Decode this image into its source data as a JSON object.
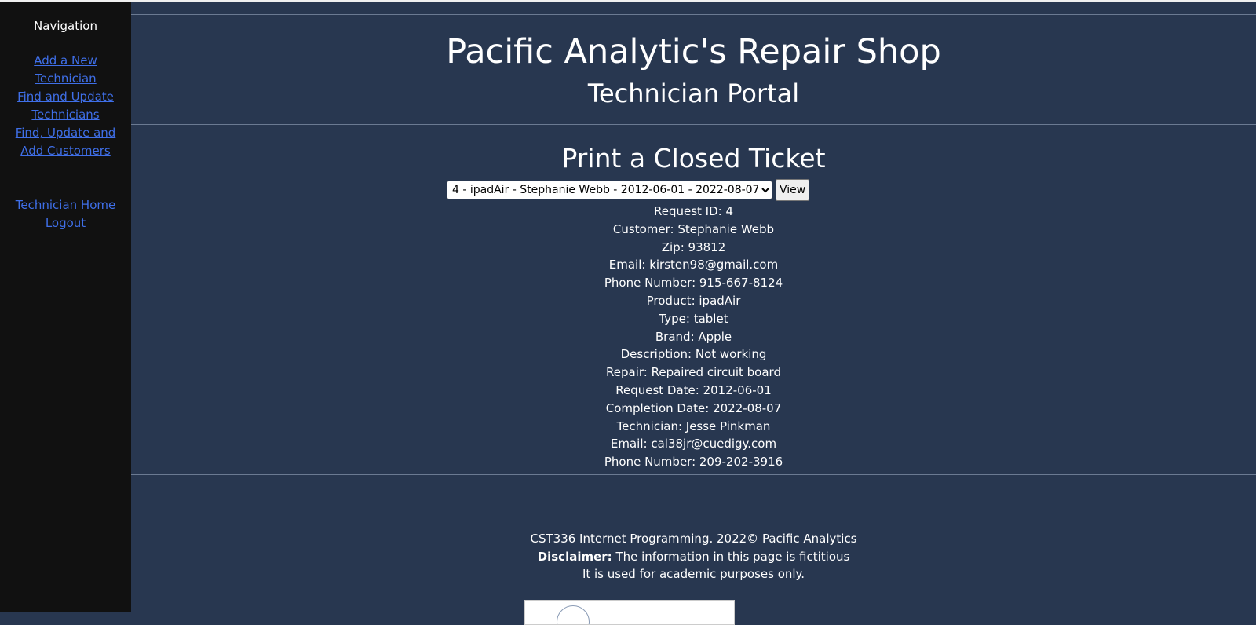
{
  "sidebar": {
    "heading": "Navigation",
    "links": [
      "Add a New Technician",
      "Find and Update Technicians",
      "Find, Update and Add Customers"
    ],
    "bottom_links": [
      "Technician Home",
      "Logout"
    ]
  },
  "header": {
    "title": "Pacific Analytic's Repair Shop",
    "subtitle": "Technician Portal"
  },
  "main": {
    "heading": "Print a Closed Ticket",
    "ticket_select": {
      "selected": "4 - ipadAir - Stephanie Webb - 2012-06-01 - 2022-08-07"
    },
    "view_button": "View",
    "details": [
      "Request ID: 4",
      "Customer: Stephanie Webb",
      "Zip: 93812",
      "Email: kirsten98@gmail.com",
      "Phone Number: 915-667-8124",
      "Product: ipadAir",
      "Type: tablet",
      "Brand: Apple",
      "Description: Not working",
      "Repair: Repaired circuit board",
      "Request Date: 2012-06-01",
      "Completion Date: 2022-08-07",
      "Technician: Jesse Pinkman",
      "Email: cal38jr@cuedigy.com",
      "Phone Number: 209-202-3916"
    ]
  },
  "footer": {
    "copyright": "CST336 Internet Programming. 2022© Pacific Analytics",
    "disclaimer_label": "Disclaimer:",
    "disclaimer_text": " The information in this page is fictitious",
    "academic_note": "It is used for academic purposes only."
  },
  "colors": {
    "background": "#283750",
    "sidebar": "#111111",
    "link": "#3f6fe8"
  }
}
